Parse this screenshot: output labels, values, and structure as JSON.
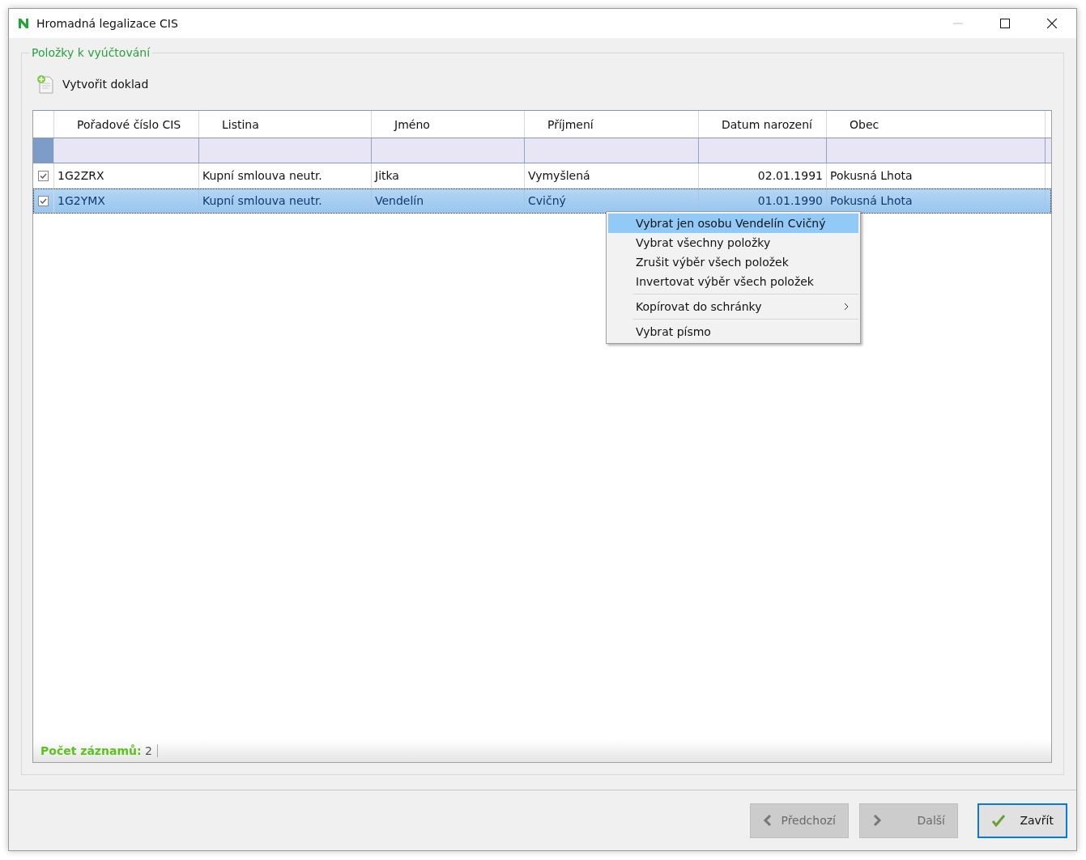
{
  "window": {
    "title": "Hromadná legalizace CIS"
  },
  "group": {
    "title": "Položky k vyúčtování"
  },
  "toolbar": [
    {
      "label": "Vytvořit doklad"
    }
  ],
  "table": {
    "columns": [
      {
        "label": "Pořadové číslo CIS",
        "kind": "text"
      },
      {
        "label": "Listina",
        "kind": "text"
      },
      {
        "label": "Jméno",
        "kind": "text"
      },
      {
        "label": "Příjmení",
        "kind": "text"
      },
      {
        "label": "Datum narození",
        "kind": "date"
      },
      {
        "label": "Obec",
        "kind": "text"
      }
    ],
    "rows": [
      {
        "checked": true,
        "selected": false,
        "cells": [
          "1G2ZRX",
          "Kupní smlouva neutr.",
          "Jitka",
          "Vymyšlená",
          "02.01.1991",
          "Pokusná Lhota"
        ]
      },
      {
        "checked": true,
        "selected": true,
        "cells": [
          "1G2YMX",
          "Kupní smlouva neutr.",
          "Vendelín",
          "Cvičný",
          "01.01.1990",
          "Pokusná Lhota"
        ]
      }
    ]
  },
  "footer": {
    "label": "Počet záznamů:",
    "value": "2"
  },
  "context_menu": {
    "items": [
      {
        "kind": "item",
        "label": "Vybrat jen osobu Vendelín Cvičný",
        "selected": true,
        "submenu": false
      },
      {
        "kind": "item",
        "label": "Vybrat všechny položky",
        "selected": false,
        "submenu": false
      },
      {
        "kind": "item",
        "label": "Zrušit výběr všech položek",
        "selected": false,
        "submenu": false
      },
      {
        "kind": "item",
        "label": "Invertovat výběr všech položek",
        "selected": false,
        "submenu": false
      },
      {
        "kind": "separator"
      },
      {
        "kind": "item",
        "label": "Kopírovat do schránky",
        "selected": false,
        "submenu": true
      },
      {
        "kind": "separator"
      },
      {
        "kind": "item",
        "label": "Vybrat písmo",
        "selected": false,
        "submenu": false
      }
    ]
  },
  "buttons": [
    {
      "kind": "back",
      "label": "Předchozí",
      "disabled": true,
      "focused": false
    },
    {
      "kind": "next",
      "label": "Další",
      "disabled": true,
      "focused": false
    },
    {
      "kind": "ok",
      "label": "Zavřít",
      "disabled": false,
      "focused": true
    }
  ]
}
